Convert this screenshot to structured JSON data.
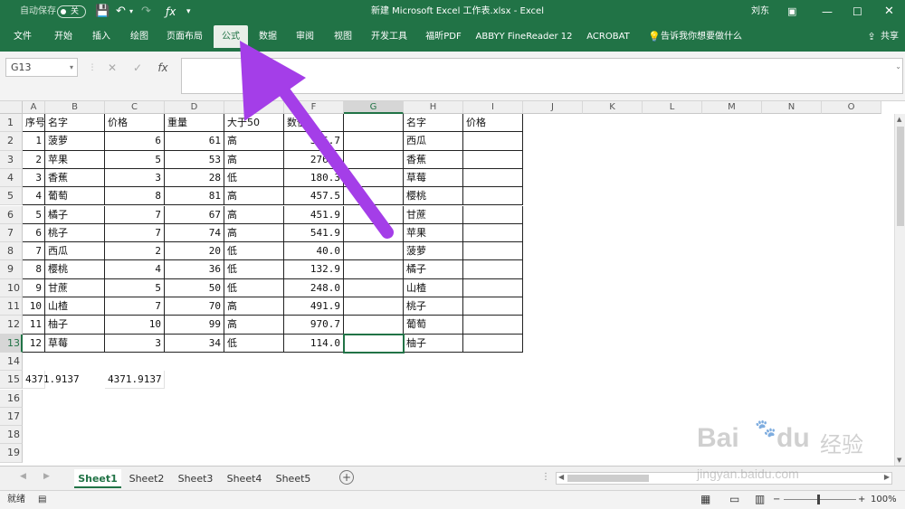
{
  "window": {
    "autosave_label": "自动保存",
    "autosave_state": "关",
    "title": "新建 Microsoft Excel 工作表.xlsx  -  Excel",
    "user": "刘东"
  },
  "ribbon": {
    "tabs": [
      "文件",
      "开始",
      "插入",
      "绘图",
      "页面布局",
      "公式",
      "数据",
      "审阅",
      "视图",
      "开发工具",
      "福昕PDF",
      "ABBYY FineReader 12",
      "ACROBAT"
    ],
    "tell_me": "告诉我你想要做什么",
    "share": "共享"
  },
  "formula_bar": {
    "name_box": "G13",
    "fx": "fx",
    "value": ""
  },
  "grid": {
    "columns": [
      "A",
      "B",
      "C",
      "D",
      "E",
      "F",
      "G",
      "H",
      "I",
      "J",
      "K",
      "L",
      "M",
      "N",
      "O"
    ],
    "rows": [
      "1",
      "2",
      "3",
      "4",
      "5",
      "6",
      "7",
      "8",
      "9",
      "10",
      "11",
      "12",
      "13",
      "14",
      "15",
      "16",
      "17",
      "18",
      "19"
    ],
    "headers": [
      "序号",
      "名字",
      "价格",
      "重量",
      "大于50",
      "数值"
    ],
    "table": [
      [
        "1",
        "菠萝",
        "6",
        "61",
        "高",
        "366.7"
      ],
      [
        "2",
        "苹果",
        "5",
        "53",
        "高",
        "276.3"
      ],
      [
        "3",
        "香蕉",
        "3",
        "28",
        "低",
        "180.3"
      ],
      [
        "4",
        "葡萄",
        "8",
        "81",
        "高",
        "457.5"
      ],
      [
        "5",
        "橘子",
        "7",
        "67",
        "高",
        "451.9"
      ],
      [
        "6",
        "桃子",
        "7",
        "74",
        "高",
        "541.9"
      ],
      [
        "7",
        "西瓜",
        "2",
        "20",
        "低",
        "40.0"
      ],
      [
        "8",
        "樱桃",
        "4",
        "36",
        "低",
        "132.9"
      ],
      [
        "9",
        "甘蔗",
        "5",
        "50",
        "低",
        "248.0"
      ],
      [
        "10",
        "山楂",
        "7",
        "70",
        "高",
        "491.9"
      ],
      [
        "11",
        "柚子",
        "10",
        "99",
        "高",
        "970.7"
      ],
      [
        "12",
        "草莓",
        "3",
        "34",
        "低",
        "114.0"
      ]
    ],
    "lookup_headers": [
      "名字",
      "价格"
    ],
    "lookup_names": [
      "西瓜",
      "香蕉",
      "草莓",
      "樱桃",
      "甘蔗",
      "苹果",
      "菠萝",
      "橘子",
      "山楂",
      "桃子",
      "葡萄",
      "柚子"
    ],
    "a15": "4371.9137",
    "c15": "4371.9137"
  },
  "sheets": [
    "Sheet1",
    "Sheet2",
    "Sheet3",
    "Sheet4",
    "Sheet5"
  ],
  "status": {
    "ready": "就绪",
    "zoom": "100%"
  },
  "watermark": {
    "brand": "Bai",
    "du": "du",
    "cn": "经验",
    "url": "jingyan.baidu.com"
  },
  "colors": {
    "excel_green": "#217346",
    "arrow": "#a43ee8"
  }
}
